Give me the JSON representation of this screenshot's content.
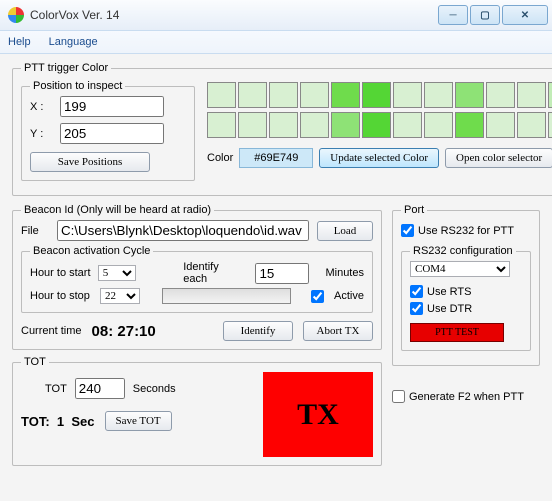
{
  "title": "ColorVox  Ver. 14",
  "menu": {
    "help": "Help",
    "language": "Language"
  },
  "ptt": {
    "legend": "PTT trigger Color",
    "pos_legend": "Position to inspect",
    "x_label": "X :",
    "x": "199",
    "y_label": "Y :",
    "y": "205",
    "save": "Save Positions",
    "color_label": "Color",
    "color_value": "#69E749",
    "update": "Update selected Color",
    "open": "Open color selector",
    "sw1": [
      "#d8f0d2",
      "#d8f0d2",
      "#d8f0d2",
      "#d8f0d2",
      "#6fdc4c",
      "#54d635",
      "#d8f0d2",
      "#d8f0d2",
      "#8ee276",
      "#d8f0d2",
      "#d8f0d2",
      "#c2ecb7"
    ],
    "sw2": [
      "#d8f0d2",
      "#d8f0d2",
      "#d8f0d2",
      "#d8f0d2",
      "#8ee276",
      "#54d635",
      "#d8f0d2",
      "#d8f0d2",
      "#6fdc4c",
      "#d8f0d2",
      "#d8f0d2",
      "#d8f0d2"
    ]
  },
  "beacon": {
    "legend": "Beacon  Id (Only will  be heard at radio)",
    "file_label": "File",
    "file": "C:\\Users\\Blynk\\Desktop\\loquendo\\id.wav",
    "load": "Load",
    "cycle_legend": "Beacon activation Cycle",
    "start_label": "Hour to start",
    "start": "5",
    "stop_label": "Hour to stop",
    "stop": "22",
    "each_label": "Identify each",
    "each": "15",
    "minutes": "Minutes",
    "active": "Active",
    "curtime_label": "Current time",
    "curtime": "08: 27:10",
    "identify": "Identify",
    "abort": "Abort TX"
  },
  "port": {
    "legend": "Port",
    "use_rs232": "Use RS232 for PTT",
    "cfg_legend": "RS232 configuration",
    "com": "COM4",
    "rts": "Use RTS",
    "dtr": "Use DTR",
    "test": "PTT TEST"
  },
  "tot": {
    "legend": "TOT",
    "tot_label": "TOT",
    "tot": "240",
    "seconds": "Seconds",
    "counter_label": "TOT:",
    "counter": "1",
    "sec": "Sec",
    "save": "Save TOT",
    "tx": "TX"
  },
  "genf2": "Generate F2 when PTT"
}
